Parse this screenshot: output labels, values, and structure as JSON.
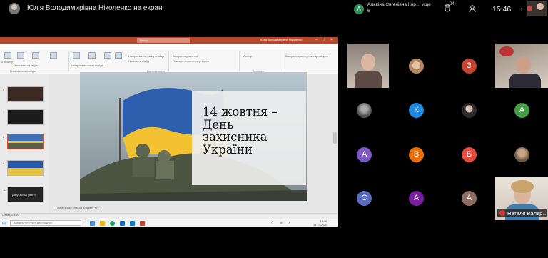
{
  "topbar": {
    "presenter_label": "Юлія Володимирівна Ніколенко на екрані",
    "notification": {
      "avatar_letter": "А",
      "text": "Альвіна Євгенівна Кор… ище 6"
    },
    "hand_count": "24",
    "clock": "15:46"
  },
  "screen": {
    "title_search": "Пошук",
    "title_user": "Юлія Володимирівна Ніколенко",
    "menu": [
      "Файл",
      "Основне",
      "Вставлення",
      "Конструктор",
      "Переходи",
      "Анімації",
      "Слайд-шоу",
      "Рецензування",
      "Вигляд",
      "Довідка"
    ],
    "menu_active": "Слайд-шоу",
    "ribbon_groups": [
      "Почати показ слайдів",
      "Настроювання",
      "Монітори"
    ],
    "ribbon_labels": [
      "З початку",
      "З поточного слайда",
      "Настроювані показ слайдів",
      "Настроювання показу слайдів",
      "Приховати слайд",
      "Відрепетирувати час",
      "Записати показ слайдів",
      "Відтворити мовлення",
      "Використовувати час",
      "Показати елементи керування",
      "Монітор",
      "Використовувати режим доповідача"
    ],
    "slide_title": "14 жовтня –\nДень\nзахисника\nУкраїни",
    "thumb_numbers": [
      "5",
      "6",
      "7",
      "8",
      "9",
      "10"
    ],
    "last_thumb_text": "Дякуємо за увагу!",
    "notes_placeholder": "Примітки до слайда додайте тут",
    "status_text": "Слайд 8 із 10",
    "taskbar_search": "Введіть тут текст для пошуку",
    "tray_clock": "15:46",
    "tray_date": "14.10.2020"
  },
  "participants": [
    {
      "type": "video"
    },
    {
      "type": "image"
    },
    {
      "type": "letter",
      "letter": "З",
      "color": "#c4452e"
    },
    {
      "type": "video"
    },
    {
      "type": "image"
    },
    {
      "type": "letter",
      "letter": "К",
      "color": "#1e88e5"
    },
    {
      "type": "image"
    },
    {
      "type": "letter",
      "letter": "А",
      "color": "#43a047"
    },
    {
      "type": "letter",
      "letter": "А",
      "color": "#7e57c2"
    },
    {
      "type": "letter",
      "letter": "В",
      "color": "#ef6c00"
    },
    {
      "type": "letter",
      "letter": "Б",
      "color": "#e64a3c"
    },
    {
      "type": "image"
    },
    {
      "type": "letter",
      "letter": "С",
      "color": "#5c6bc0"
    },
    {
      "type": "letter",
      "letter": "А",
      "color": "#7b1fa2"
    },
    {
      "type": "letter",
      "letter": "А",
      "color": "#8d6e63"
    },
    {
      "type": "video"
    }
  ],
  "speaker_name": "Наталя Валер…"
}
